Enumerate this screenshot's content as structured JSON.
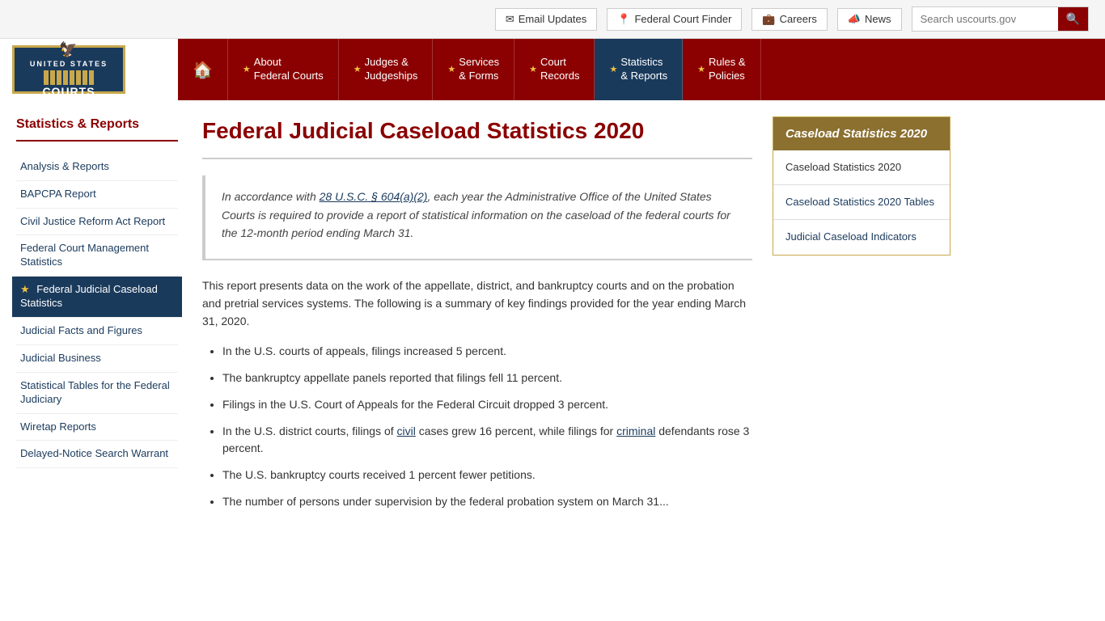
{
  "topbar": {
    "email_updates": "Email Updates",
    "federal_court_finder": "Federal Court Finder",
    "careers": "Careers",
    "news": "News",
    "search_placeholder": "Search uscourts.gov"
  },
  "nav": {
    "home_icon": "🏠",
    "items": [
      {
        "id": "about",
        "line1": "About",
        "line2": "Federal Courts"
      },
      {
        "id": "judges",
        "line1": "Judges &",
        "line2": "Judgeships"
      },
      {
        "id": "services",
        "line1": "Services",
        "line2": "& Forms"
      },
      {
        "id": "court",
        "line1": "Court",
        "line2": "Records"
      },
      {
        "id": "statistics",
        "line1": "Statistics",
        "line2": "& Reports",
        "active": true
      },
      {
        "id": "rules",
        "line1": "Rules &",
        "line2": "Policies"
      }
    ]
  },
  "sidebar": {
    "title": "Statistics & Reports",
    "items": [
      {
        "id": "analysis",
        "label": "Analysis & Reports",
        "active": false
      },
      {
        "id": "bapcpa",
        "label": "BAPCPA Report",
        "active": false
      },
      {
        "id": "civil-justice",
        "label": "Civil Justice Reform Act Report",
        "active": false
      },
      {
        "id": "federal-court-mgmt",
        "label": "Federal Court Management Statistics",
        "active": false
      },
      {
        "id": "federal-judicial",
        "label": "Federal Judicial Caseload Statistics",
        "active": true
      },
      {
        "id": "judicial-facts",
        "label": "Judicial Facts and Figures",
        "active": false
      },
      {
        "id": "judicial-business",
        "label": "Judicial Business",
        "active": false
      },
      {
        "id": "statistical-tables",
        "label": "Statistical Tables for the Federal Judiciary",
        "active": false
      },
      {
        "id": "wiretap",
        "label": "Wiretap Reports",
        "active": false
      },
      {
        "id": "delayed-notice",
        "label": "Delayed-Notice Search Warrant",
        "active": false
      }
    ]
  },
  "content": {
    "title": "Federal Judicial Caseload Statistics 2020",
    "quote_prefix": "In accordance with ",
    "quote_link_text": "28 U.S.C. § 604(a)(2)",
    "quote_suffix": ", each year the Administrative Office of the United States Courts is required to provide a report of statistical information on the caseload of the federal courts for the 12-month period ending March 31.",
    "intro": "This report presents data on the work of the appellate, district, and bankruptcy courts and on the probation and pretrial services systems. The following is a summary of key findings provided for the year ending March 31, 2020.",
    "bullets": [
      "In the U.S. courts of appeals, filings increased 5 percent.",
      "The bankruptcy appellate panels reported that filings fell 11 percent.",
      "Filings in the U.S. Court of Appeals for the Federal Circuit dropped 3 percent.",
      "In the U.S. district courts, filings of civil cases grew 16 percent, while filings for criminal defendants rose 3 percent.",
      "The U.S. bankruptcy courts received 1 percent fewer petitions.",
      "The number of persons under supervision by the federal probation system on March 31..."
    ]
  },
  "right_panel": {
    "title": "Caseload Statistics 2020",
    "items": [
      {
        "id": "caseload-2020",
        "label": "Caseload Statistics 2020",
        "link": true
      },
      {
        "id": "caseload-tables",
        "label": "Caseload Statistics 2020 Tables",
        "link": true
      },
      {
        "id": "judicial-indicators",
        "label": "Judicial Caseload Indicators",
        "link": true
      }
    ]
  }
}
